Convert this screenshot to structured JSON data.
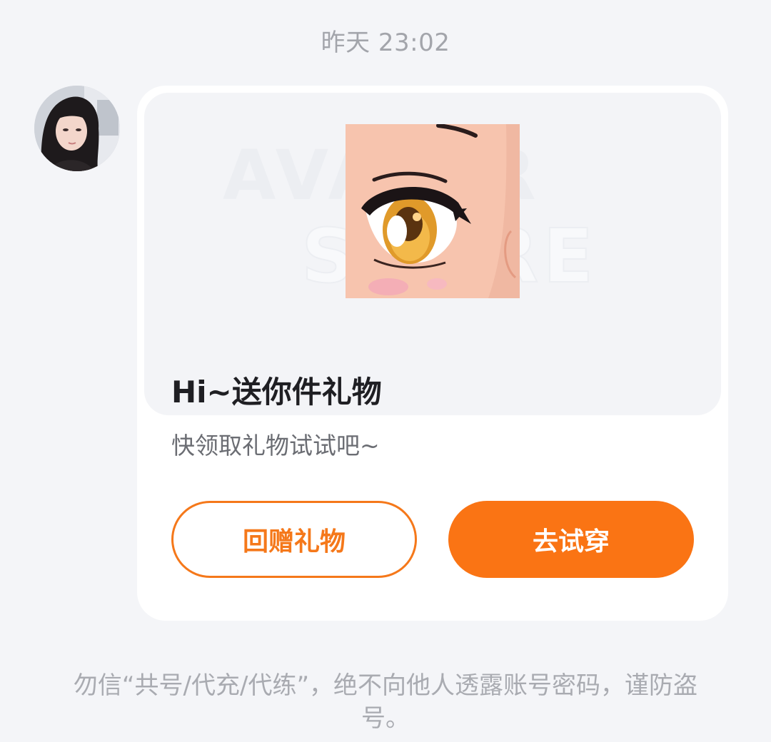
{
  "chat": {
    "timestamp": "昨天 23:02"
  },
  "sender": {
    "avatar_icon": "user-avatar-photo"
  },
  "gift_card": {
    "banner_watermark_line1": "AVATAR",
    "banner_watermark_line2": "STORE",
    "thumbnail_icon": "anime-eye-item-preview",
    "title": "Hi~送你件礼物",
    "subtitle": "快领取礼物试试吧~",
    "return_gift_label": "回赠礼物",
    "try_on_label": "去试穿",
    "accent_color": "#fa7414"
  },
  "notice": {
    "text": "勿信“共号/代充/代练”，绝不向他人透露账号密码，谨防盗号。"
  }
}
